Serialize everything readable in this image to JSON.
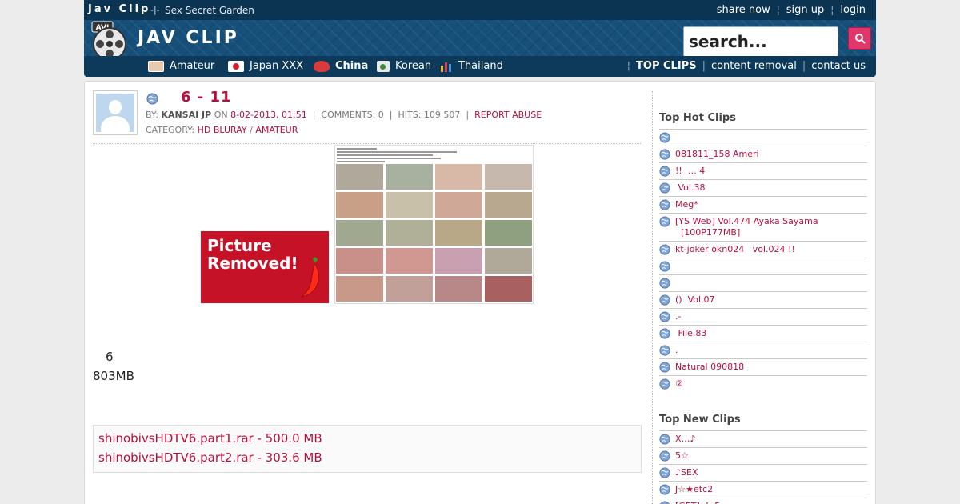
{
  "header": {
    "brand": "Jav Clip",
    "separator": "-|-",
    "tagline": "Sex Secret Garden",
    "logo_text": "JAV CLIP",
    "logo_badge": "AVI",
    "top_links": [
      "share now",
      "sign up",
      "login"
    ],
    "search": {
      "placeholder": "search..."
    }
  },
  "nav": {
    "items": [
      {
        "label": "Amateur",
        "icon": "amateur-icon",
        "color": "#e8c9b0"
      },
      {
        "label": "Japan XXX",
        "icon": "japan-flag-icon",
        "color": "#ffffff"
      },
      {
        "label": "China",
        "icon": "china-icon",
        "color": "#d83b3b"
      },
      {
        "label": "Korean",
        "icon": "korean-icon",
        "color": "#e9e9e9"
      },
      {
        "label": "Thailand",
        "icon": "chart-icon",
        "color": "#f0b030"
      }
    ],
    "right": [
      "TOP CLIPS",
      "content removal",
      "contact us"
    ]
  },
  "post": {
    "title": "6 - 11",
    "by_label": "BY:",
    "author": "KANSAI JP",
    "on_label": "ON",
    "date": "8-02-2013, 01:51",
    "comments": "COMMENTS: 0",
    "hits": "HITS: 109 507",
    "report": "REPORT ABUSE",
    "category_label": "CATEGORY:",
    "categories": [
      "HD BLURAY",
      "AMATEUR"
    ],
    "removed_line1": "Picture",
    "removed_line2": "Removed!",
    "desc_line1": "6",
    "desc_line2": "803MB",
    "files": [
      "shinobivsHDTV6.part1.rar - 500.0 MB",
      "shinobivsHDTV6.part2.rar - 303.6 MB"
    ]
  },
  "sidebar": {
    "hot_title": "Top Hot Clips",
    "hot": [
      "",
      "081811_158 Ameri",
      "!!  … 4",
      " Vol.38",
      "Meg*",
      "[YS Web] Vol.474 Ayaka Sayama\n  [100P177MB]",
      "kt-joker okn024   vol.024 !!",
      "",
      "",
      "()  Vol.07",
      ".-",
      " File.83",
      ".",
      "Natural 090818",
      "②"
    ],
    "new_title": "Top New Clips",
    "new": [
      "X…♪",
      "5☆",
      "♪SEX",
      "J☆★etc2",
      "[GET]  !  5"
    ]
  },
  "colors": {
    "accent": "#b5103c",
    "header": "#0f3f63",
    "search_button": "#e0366c"
  }
}
